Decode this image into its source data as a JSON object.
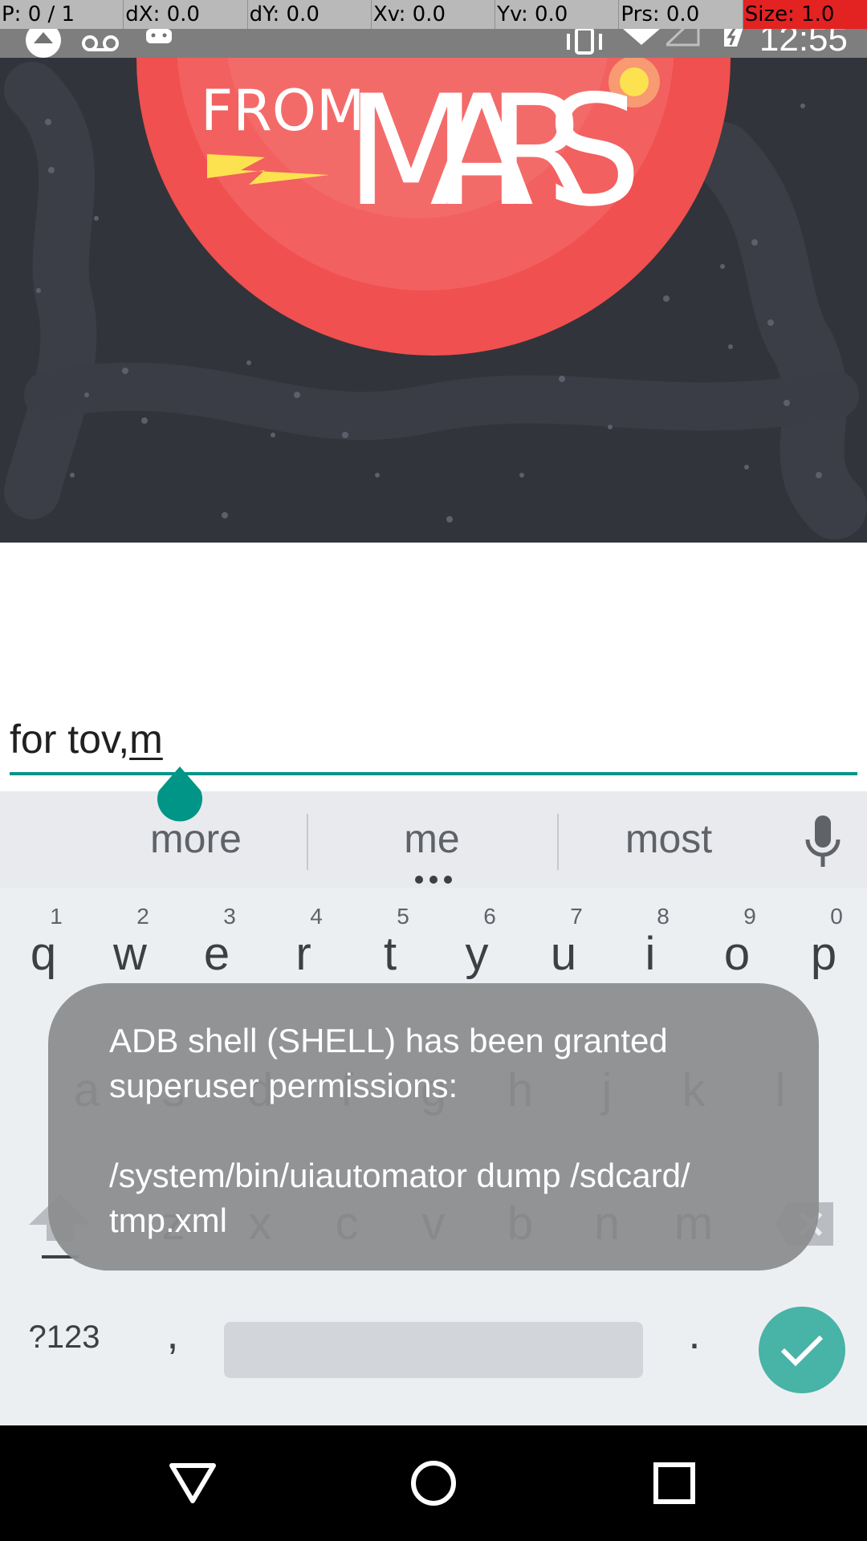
{
  "pointer_overlay": {
    "cells": [
      "P: 0 / 1",
      "dX: 0.0",
      "dY: 0.0",
      "Xv: 0.0",
      "Yv: 0.0",
      "Prs: 0.0",
      "Size: 1.0"
    ]
  },
  "status_bar": {
    "time": "12:55",
    "icons": [
      "notification-icon",
      "voicemail-icon",
      "android-icon",
      "vibrate-icon",
      "wifi-icon",
      "signal-icon",
      "battery-charging-icon"
    ]
  },
  "hero": {
    "art_text_small": "FROM",
    "art_text_large": "MARS",
    "colors": {
      "background": "#31343b",
      "planet": "#f0504f",
      "accent": "#fde24f"
    }
  },
  "input": {
    "value_plain": "for tov,",
    "value_composing": "m",
    "accent_color": "#009587"
  },
  "keyboard": {
    "suggestions": [
      "more",
      "me",
      "most"
    ],
    "row1": [
      {
        "hint": "1",
        "key": "q"
      },
      {
        "hint": "2",
        "key": "w"
      },
      {
        "hint": "3",
        "key": "e"
      },
      {
        "hint": "4",
        "key": "r"
      },
      {
        "hint": "5",
        "key": "t"
      },
      {
        "hint": "6",
        "key": "y"
      },
      {
        "hint": "7",
        "key": "u"
      },
      {
        "hint": "8",
        "key": "i"
      },
      {
        "hint": "9",
        "key": "o"
      },
      {
        "hint": "0",
        "key": "p"
      }
    ],
    "row2": [
      "a",
      "s",
      "d",
      "f",
      "g",
      "h",
      "j",
      "k",
      "l"
    ],
    "row3": [
      "z",
      "x",
      "c",
      "v",
      "b",
      "n",
      "m"
    ],
    "symbols_label": "?123",
    "comma": ",",
    "period": ".",
    "enter_color": "#48b3a7"
  },
  "toast": {
    "line1": "ADB shell (SHELL) has been granted",
    "line2": "superuser permissions:",
    "line3": "/system/bin/uiautomator dump /sdcard/",
    "line4": "tmp.xml"
  },
  "nav_bar": {
    "buttons": [
      "back-icon",
      "home-icon",
      "recents-icon"
    ]
  }
}
